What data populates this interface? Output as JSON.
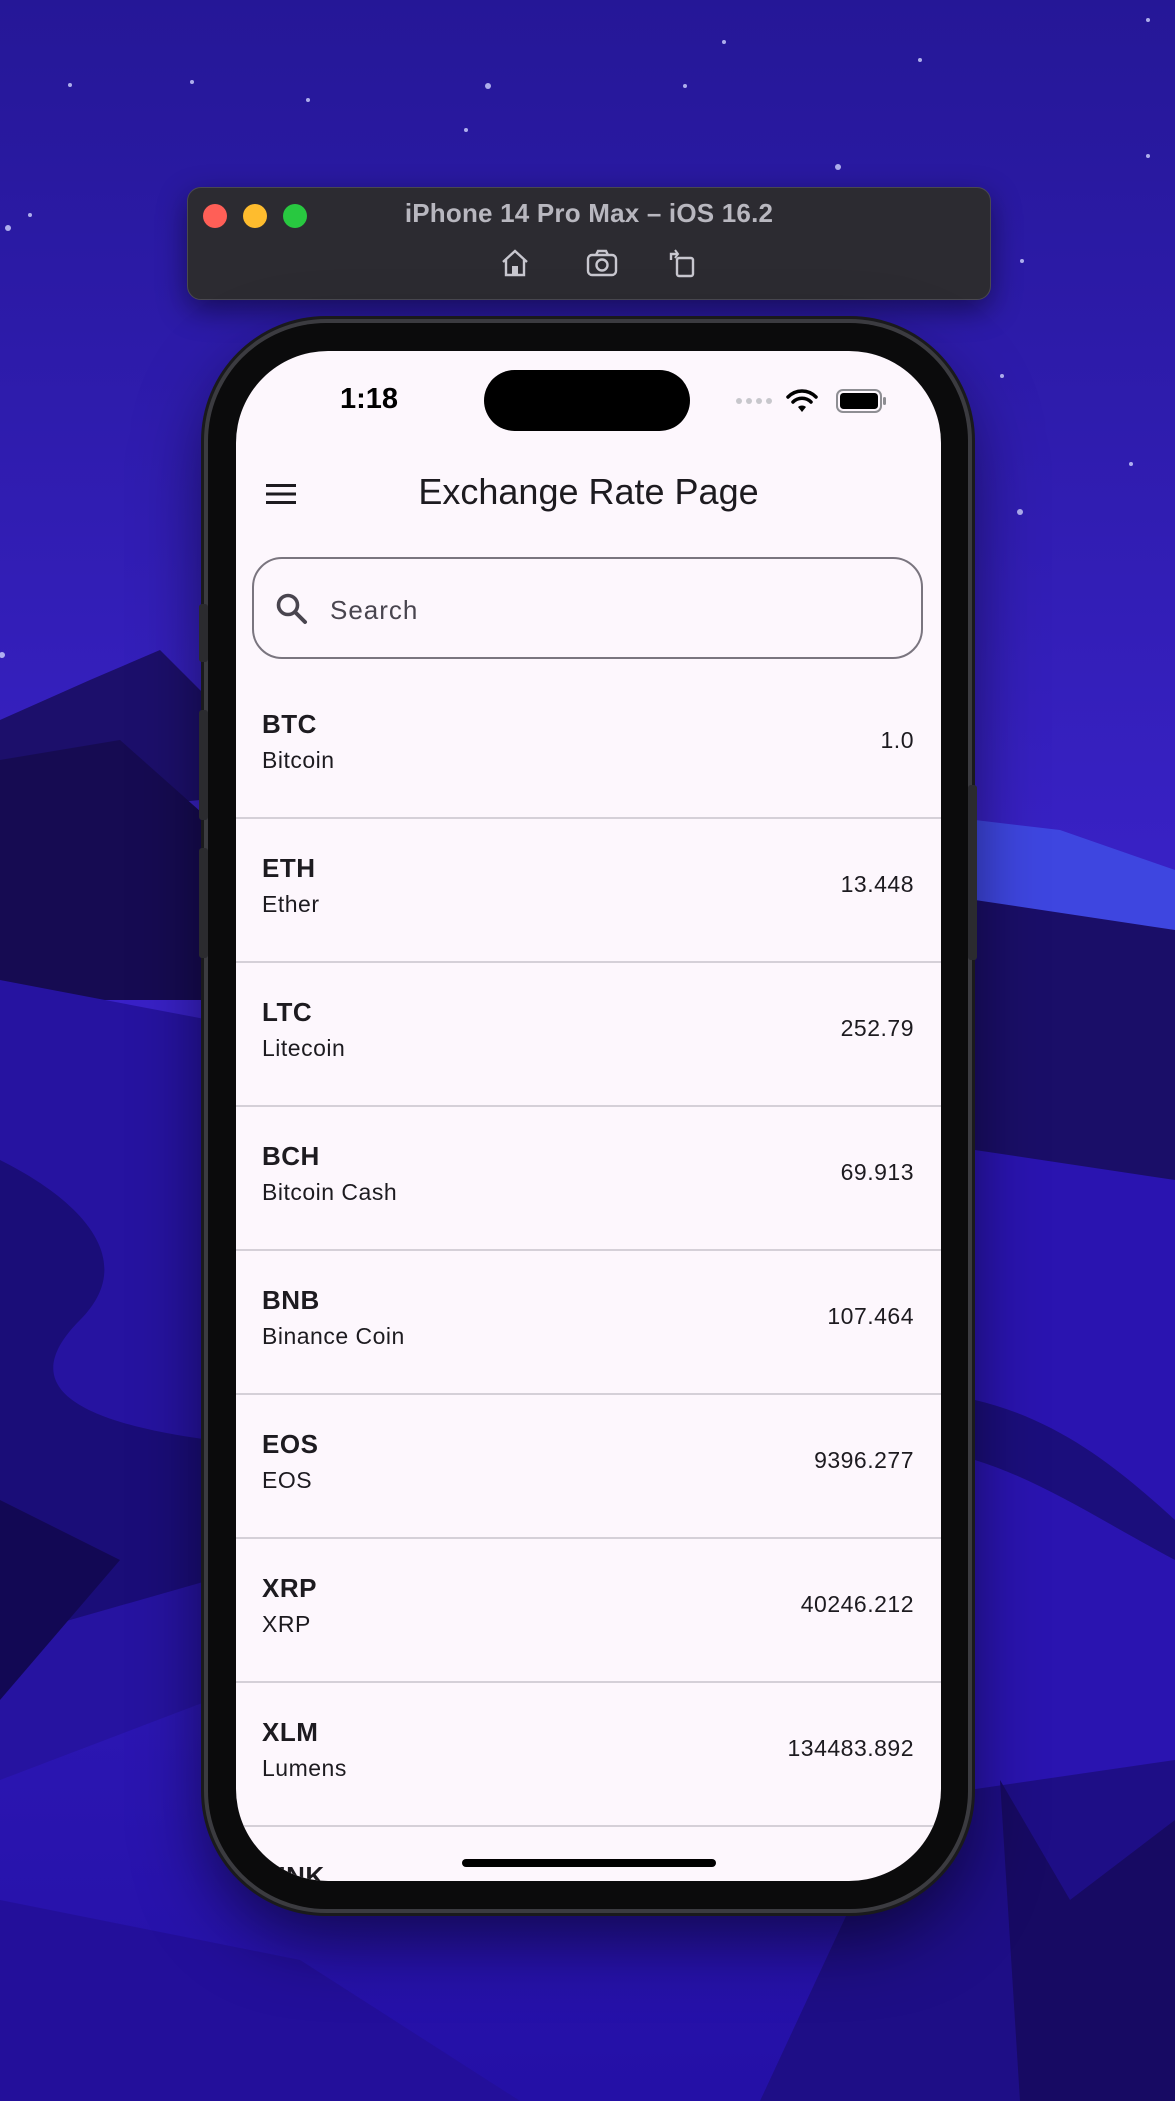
{
  "simulator": {
    "title": "iPhone 14 Pro Max – iOS 16.2",
    "tools": [
      "home-icon",
      "screenshot-icon",
      "rotate-icon"
    ]
  },
  "status_bar": {
    "time": "1:18",
    "icons": [
      "cellular-signal-icon",
      "wifi-icon",
      "battery-icon"
    ]
  },
  "app_bar": {
    "title": "Exchange Rate Page",
    "menu_icon": "hamburger-menu-icon"
  },
  "search": {
    "placeholder": "Search",
    "value": "",
    "icon": "search-icon"
  },
  "rates": [
    {
      "symbol": "BTC",
      "name": "Bitcoin",
      "rate": "1.0"
    },
    {
      "symbol": "ETH",
      "name": "Ether",
      "rate": "13.448"
    },
    {
      "symbol": "LTC",
      "name": "Litecoin",
      "rate": "252.79"
    },
    {
      "symbol": "BCH",
      "name": "Bitcoin Cash",
      "rate": "69.913"
    },
    {
      "symbol": "BNB",
      "name": "Binance Coin",
      "rate": "107.464"
    },
    {
      "symbol": "EOS",
      "name": "EOS",
      "rate": "9396.277"
    },
    {
      "symbol": "XRP",
      "name": "XRP",
      "rate": "40246.212"
    },
    {
      "symbol": "XLM",
      "name": "Lumens",
      "rate": "134483.892"
    },
    {
      "symbol": "LINK",
      "name": "",
      "rate": ""
    }
  ],
  "colors": {
    "screen_background": "#fdf7fd",
    "text": "#1d1b20",
    "divider": "#d5d0d8",
    "wallpaper": "#2a16a8"
  }
}
